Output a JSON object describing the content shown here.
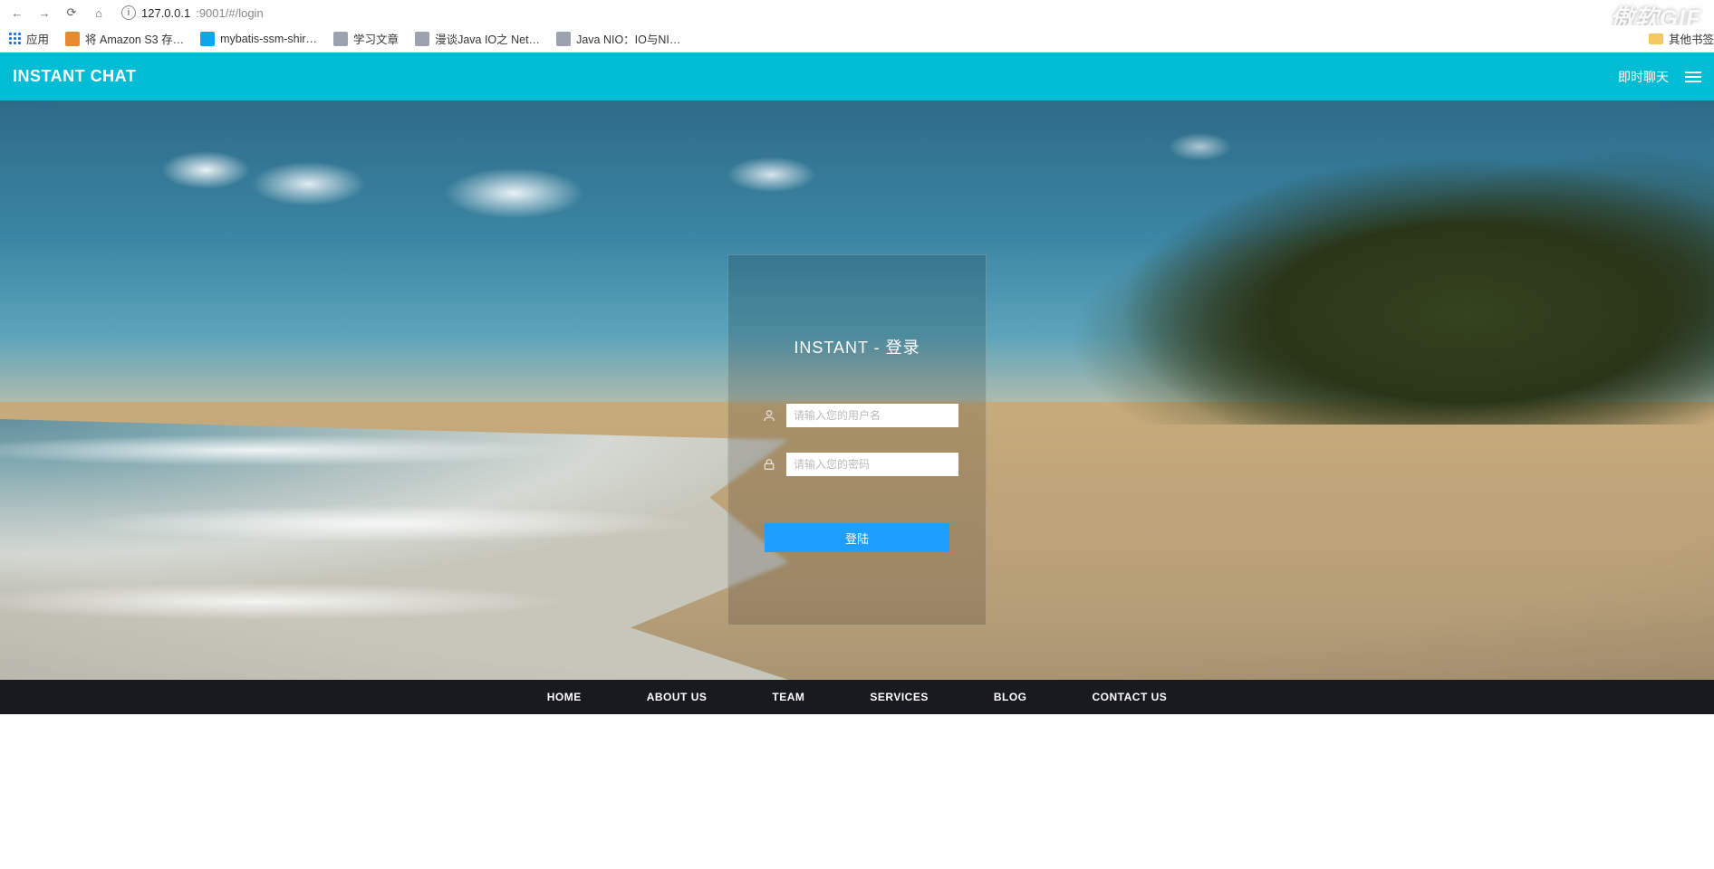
{
  "browser": {
    "url_host": "127.0.0.1",
    "url_rest": ":9001/#/login",
    "bookmarks": {
      "apps_label": "应用",
      "items": [
        "将 Amazon S3 存…",
        "mybatis-ssm-shir…",
        "学习文章",
        "漫谈Java IO之 Net…",
        "Java NIO：IO与NI…"
      ],
      "other_label": "其他书签"
    }
  },
  "topnav": {
    "brand": "INSTANT CHAT",
    "link_label": "即时聊天"
  },
  "login": {
    "title": "INSTANT - 登录",
    "username_placeholder": "请输入您的用户名",
    "password_placeholder": "请输入您的密码",
    "submit_label": "登陆"
  },
  "footer": {
    "items": [
      "HOME",
      "ABOUT US",
      "TEAM",
      "SERVICES",
      "BLOG",
      "CONTACT US"
    ]
  },
  "watermark": "傲软GIF"
}
